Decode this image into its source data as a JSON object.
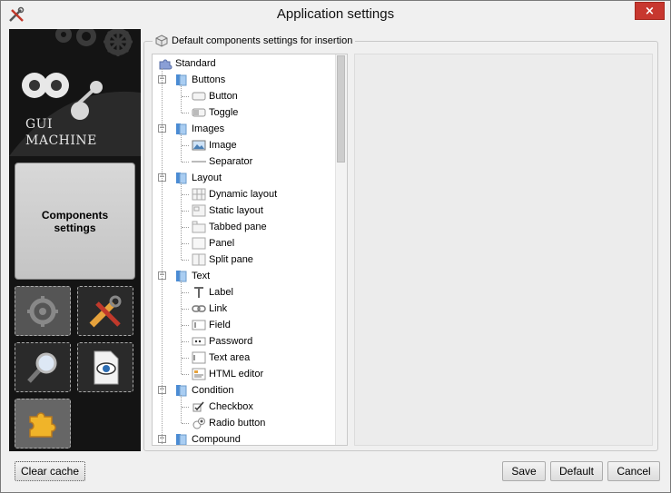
{
  "window": {
    "title": "Application settings",
    "close_label": "×"
  },
  "sidebar": {
    "logo_line1": "GUI",
    "logo_line2": "MACHINE",
    "components_button": "Components settings",
    "tiles": [
      "gears-icon",
      "tools-icon",
      "magnifier-icon",
      "document-eye-icon",
      "puzzle-icon"
    ]
  },
  "group": {
    "title": "Default components settings for insertion"
  },
  "tree": {
    "root": "Standard",
    "categories": [
      {
        "label": "Buttons",
        "items": [
          {
            "label": "Button",
            "icon": "button-icon"
          },
          {
            "label": "Toggle",
            "icon": "toggle-icon"
          }
        ]
      },
      {
        "label": "Images",
        "items": [
          {
            "label": "Image",
            "icon": "image-icon"
          },
          {
            "label": "Separator",
            "icon": "separator-icon"
          }
        ]
      },
      {
        "label": "Layout",
        "items": [
          {
            "label": "Dynamic layout",
            "icon": "dynamic-layout-icon"
          },
          {
            "label": "Static layout",
            "icon": "static-layout-icon"
          },
          {
            "label": "Tabbed pane",
            "icon": "tabbed-pane-icon"
          },
          {
            "label": "Panel",
            "icon": "panel-icon"
          },
          {
            "label": "Split pane",
            "icon": "split-pane-icon"
          }
        ]
      },
      {
        "label": "Text",
        "items": [
          {
            "label": "Label",
            "icon": "label-icon"
          },
          {
            "label": "Link",
            "icon": "link-icon"
          },
          {
            "label": "Field",
            "icon": "field-icon"
          },
          {
            "label": "Password",
            "icon": "password-icon"
          },
          {
            "label": "Text area",
            "icon": "text-area-icon"
          },
          {
            "label": "HTML editor",
            "icon": "html-editor-icon"
          }
        ]
      },
      {
        "label": "Condition",
        "items": [
          {
            "label": "Checkbox",
            "icon": "checkbox-icon"
          },
          {
            "label": "Radio button",
            "icon": "radio-button-icon"
          }
        ]
      },
      {
        "label": "Compound",
        "items": []
      }
    ]
  },
  "footer": {
    "clear_cache": "Clear cache",
    "save": "Save",
    "default": "Default",
    "cancel": "Cancel"
  }
}
